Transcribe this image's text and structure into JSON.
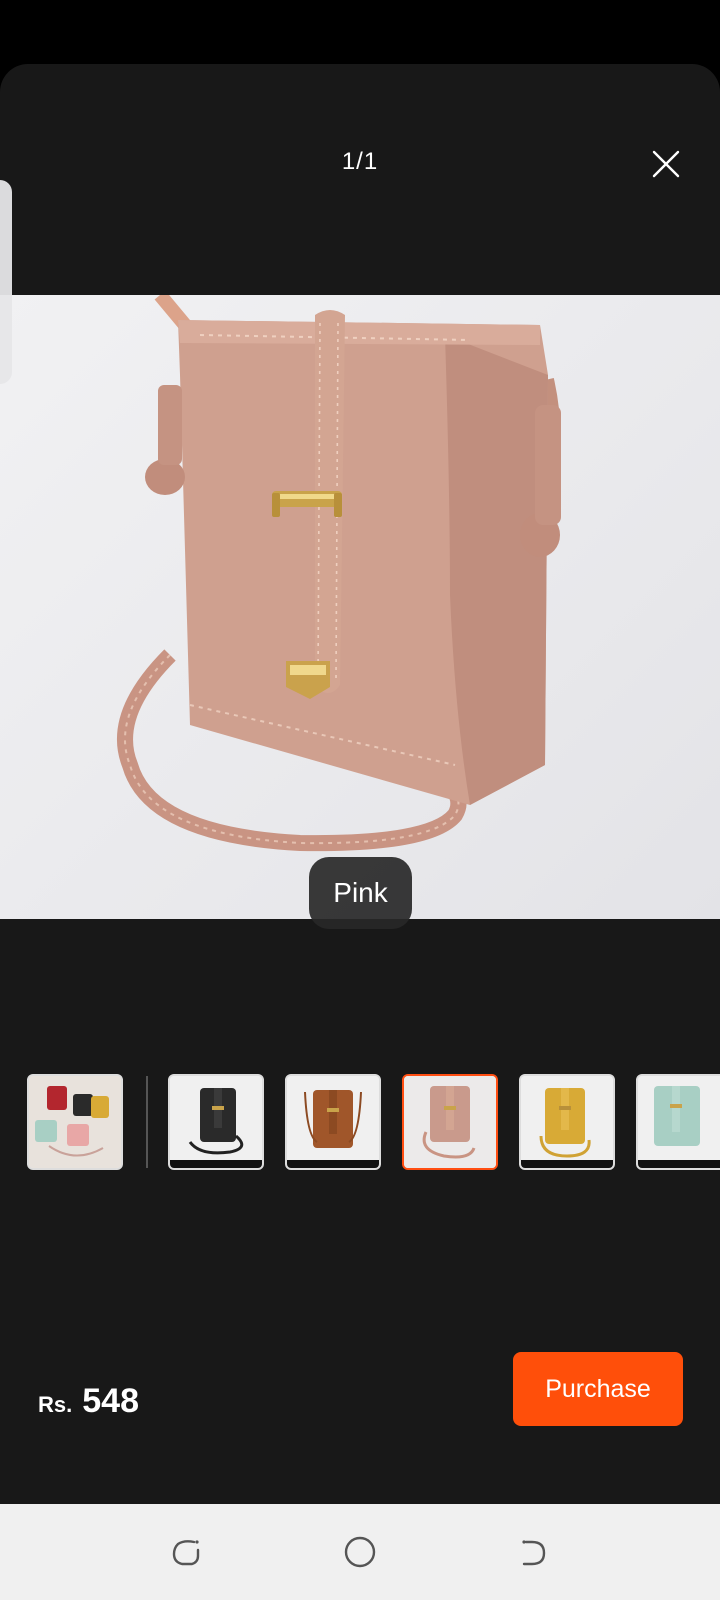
{
  "viewer": {
    "counter": "1/1",
    "variant_label": "Pink"
  },
  "thumbnails": [
    {
      "name": "All colors",
      "color": "#e8e2dc",
      "selected": false
    },
    {
      "name": "Black",
      "color": "#2a2a2a",
      "selected": false
    },
    {
      "name": "Brown",
      "color": "#a0562a",
      "selected": false
    },
    {
      "name": "Pink",
      "color": "#c99a8c",
      "selected": true
    },
    {
      "name": "Yellow",
      "color": "#d8aa36",
      "selected": false
    },
    {
      "name": "Mint",
      "color": "#a8cfc4",
      "selected": false
    }
  ],
  "footer": {
    "currency": "Rs.",
    "price": "548",
    "purchase_label": "Purchase"
  },
  "colors": {
    "accent": "#ff4f0a",
    "sheet_bg": "#181818"
  },
  "icons": {
    "close": "close-icon",
    "recent": "recent-apps-icon",
    "home": "home-icon",
    "back": "back-icon"
  }
}
